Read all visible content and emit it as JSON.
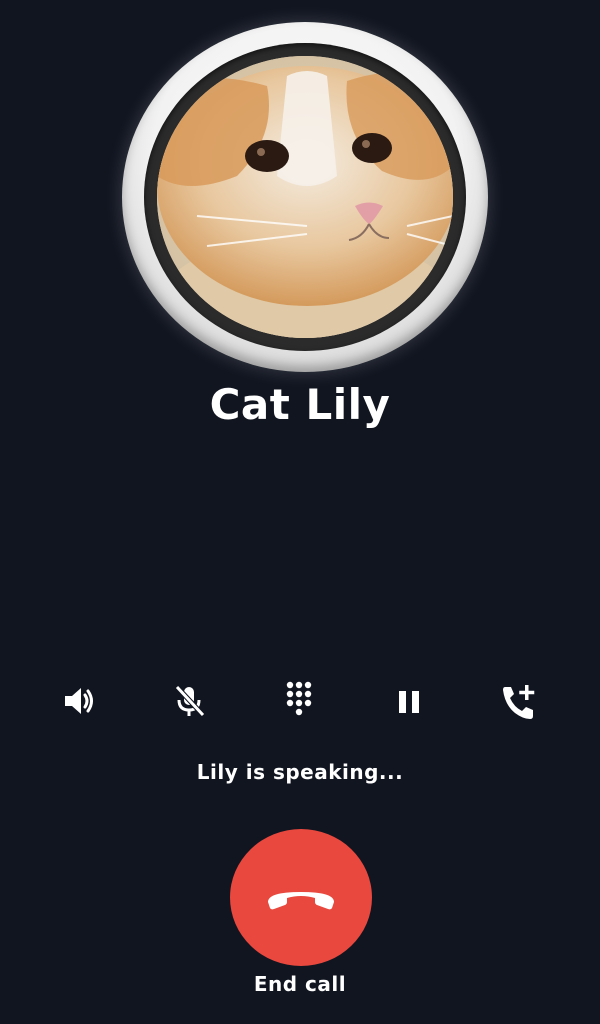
{
  "call": {
    "caller_name": "Cat Lily",
    "status": "Lily is speaking...",
    "end_call_label": "End call"
  },
  "avatar": {
    "subject": "orange-and-white cat photo"
  },
  "controls": [
    {
      "name": "speaker",
      "icon": "speaker-icon"
    },
    {
      "name": "mute",
      "icon": "microphone-off-icon"
    },
    {
      "name": "keypad",
      "icon": "dialpad-icon"
    },
    {
      "name": "hold",
      "icon": "pause-icon"
    },
    {
      "name": "add-call",
      "icon": "add-call-icon"
    }
  ],
  "colors": {
    "background": "#111520",
    "end_call": "#e8483e",
    "text": "#ffffff"
  }
}
